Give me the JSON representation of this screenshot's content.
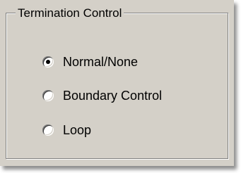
{
  "group": {
    "title": "Termination Control"
  },
  "options": [
    {
      "label": "Normal/None",
      "selected": true
    },
    {
      "label": "Boundary Control",
      "selected": false
    },
    {
      "label": "Loop",
      "selected": false
    }
  ],
  "colors": {
    "panel_background": "#d4d0c8",
    "border_dark": "#808080",
    "border_light": "#ffffff"
  }
}
